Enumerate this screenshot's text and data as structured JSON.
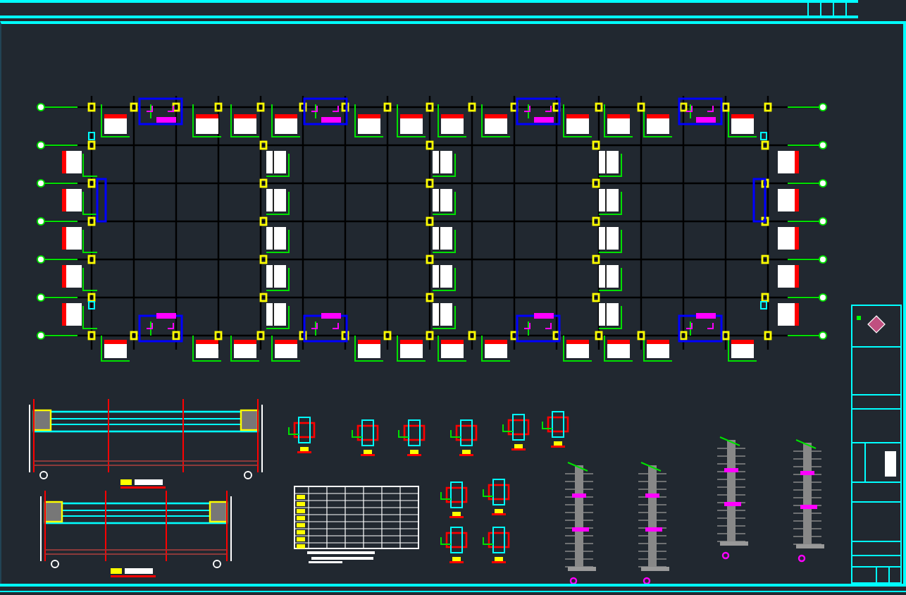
{
  "plan": {
    "kind": "floor-plan"
  },
  "details": [
    {
      "kind": "beam-elevation"
    },
    {
      "kind": "beam-elevation"
    },
    {
      "kind": "node"
    },
    {
      "kind": "node"
    },
    {
      "kind": "node"
    },
    {
      "kind": "node"
    },
    {
      "kind": "node"
    },
    {
      "kind": "node"
    },
    {
      "kind": "node"
    },
    {
      "kind": "node"
    },
    {
      "kind": "node"
    },
    {
      "kind": "node"
    },
    {
      "kind": "schedule-table"
    },
    {
      "kind": "wall-section"
    },
    {
      "kind": "wall-section"
    },
    {
      "kind": "wall-section"
    },
    {
      "kind": "wall-section"
    }
  ],
  "title_block": {
    "kind": "cells"
  }
}
